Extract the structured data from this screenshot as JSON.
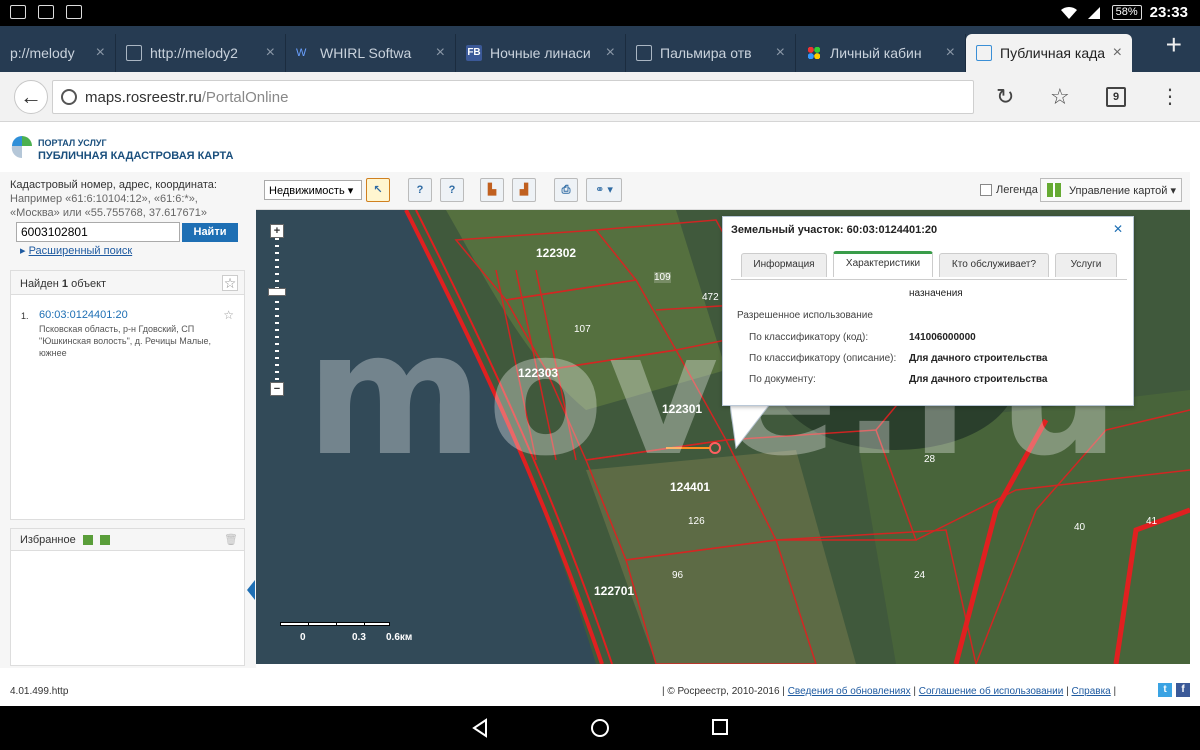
{
  "status_bar": {
    "time": "23:33",
    "battery": "58%"
  },
  "tabs": [
    {
      "label": "p://melody"
    },
    {
      "label": "http://melody2"
    },
    {
      "label": "WHIRL Softwa"
    },
    {
      "label": "Ночные линаси"
    },
    {
      "label": "Пальмира отв"
    },
    {
      "label": "Личный кабин"
    },
    {
      "label": "Публичная када"
    }
  ],
  "omnibox": {
    "url_host": "maps.rosreestr.ru",
    "url_path": "/PortalOnline",
    "tab_count": "9"
  },
  "portal": {
    "subtitle": "ПОРТАЛ УСЛУГ",
    "title": "ПУБЛИЧНАЯ КАДАСТРОВАЯ КАРТА"
  },
  "search": {
    "hint_line1": "Кадастровый номер, адрес, координата:",
    "hint_line2": "Например «61:6:10104:12», «61:6:*»,",
    "hint_line3": "«Москва» или «55.755768, 37.617671»",
    "value": "6003102801",
    "button": "Найти",
    "advanced": "Расширенный поиск"
  },
  "results": {
    "header_prefix": "Найден",
    "header_count": "1",
    "header_suffix": "объект",
    "item_num": "1.",
    "item_link": "60:03:0124401:20",
    "item_addr": "Псковская область, р-н Гдовский, СП \"Юшкинская волость\", д. Речицы Малые, южнее"
  },
  "favorites": {
    "title": "Избранное"
  },
  "map_toolbar": {
    "select_value": "Недвижимость",
    "legend_label": "Легенда",
    "management_label": "Управление картой"
  },
  "map": {
    "watermark": "move.ru",
    "scale_labels": [
      "0",
      "0.3",
      "0.6км"
    ],
    "parcel_labels": [
      "122302",
      "122303",
      "122301",
      "124401",
      "122701",
      "109",
      "107",
      "472",
      "28",
      "40",
      "41",
      "126",
      "96",
      "24"
    ]
  },
  "popup": {
    "title": "Земельный участок: 60:03:0124401:20",
    "tabs": [
      "Информация",
      "Характеристики",
      "Кто обслуживает?",
      "Услуги"
    ],
    "active_tab": "Характеристики",
    "rows": [
      {
        "k": "",
        "v": "назначения"
      },
      {
        "k": "Разрешенное использование",
        "v": ""
      },
      {
        "k": "По классификатору (код):",
        "v": "141006000000"
      },
      {
        "k": "По классификатору (описание):",
        "v": "Для дачного строительства"
      },
      {
        "k": "По документу:",
        "v": "Для дачного строительства"
      }
    ]
  },
  "footer": {
    "version": "4.01.499.http",
    "copyright": "| © Росреестр, 2010-2016 |",
    "link1": "Сведения об обновлениях",
    "link2": "Соглашение об использовании",
    "link3": "Справка"
  },
  "colors": {
    "accent": "#1e6fb4",
    "parcel_red": "#e02020",
    "tab_bar": "#263b52"
  }
}
